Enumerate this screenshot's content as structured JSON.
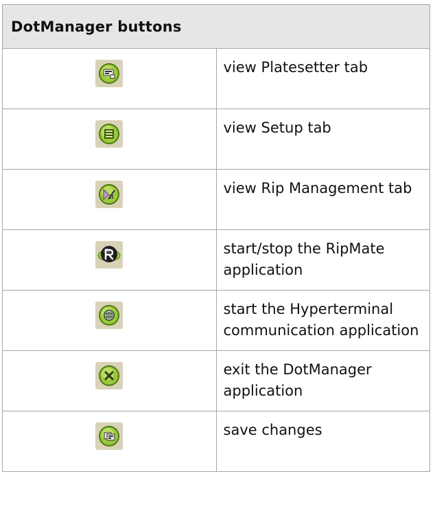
{
  "table": {
    "header": "DotManager buttons",
    "rows": [
      {
        "icon": "platesetter-icon",
        "label": "view Platesetter tab"
      },
      {
        "icon": "setup-icon",
        "label": "view Setup tab"
      },
      {
        "icon": "rip-management-icon",
        "label": "view Rip Management tab"
      },
      {
        "icon": "ripmate-icon",
        "label": "start/stop the RipMate application"
      },
      {
        "icon": "hyperterminal-icon",
        "label": "start the Hyperterminal communication application"
      },
      {
        "icon": "exit-icon",
        "label": "exit the DotManager application"
      },
      {
        "icon": "save-icon",
        "label": "save changes"
      }
    ]
  },
  "colors": {
    "button_tile": "#d8d2b8",
    "button_green": "#9bc83a",
    "button_green_dark": "#4e7a12",
    "ripmate_dark": "#1f1f1f"
  }
}
